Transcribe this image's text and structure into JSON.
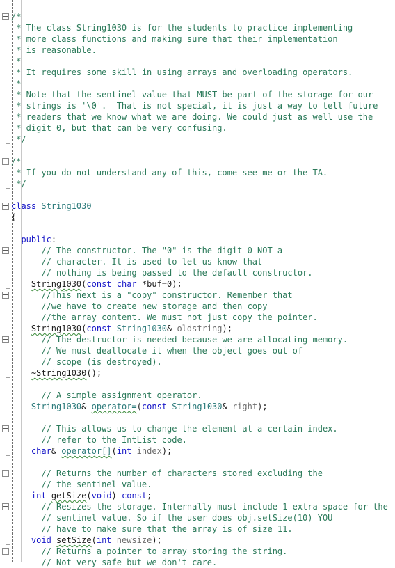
{
  "editor": {
    "language": "C++",
    "colors": {
      "comment": "#2b7a5a",
      "keyword": "#1818c8",
      "type": "#2b7a7a",
      "plain": "#1e1e1e",
      "parameter": "#6e6e6e"
    },
    "header_comment": {
      "open": "/*",
      "lines": [
        "* The class String1030 is for the students to practice implementing",
        "* more class functions and making sure that their implementation",
        "* is reasonable.",
        "*",
        "* It requires some skill in using arrays and overloading operators.",
        "*",
        "* Note that the sentinel value that MUST be part of the storage for our",
        "* strings is '\\0'.  That is not special, it is just a way to tell future",
        "* readers that we know what we are doing. We could just as well use the",
        "* digit 0, but that can be very confusing."
      ],
      "close": "*/"
    },
    "help_comment": {
      "open": "/*",
      "lines": [
        "* If you do not understand any of this, come see me or the TA."
      ],
      "close": "*/"
    },
    "class_decl": {
      "keyword": "class",
      "name": "String1030",
      "open_brace": "{",
      "access": "public",
      "access_colon": ":"
    },
    "members": {
      "ctor_comment": [
        "// The constructor. The \"0\" is the digit 0 NOT a",
        "// character. It is used to let us know that",
        "// nothing is being passed to the default constructor."
      ],
      "ctor": {
        "name": "String1030",
        "open": "(",
        "kw1": "const",
        "kw2": "char",
        "rest": " *buf=0);"
      },
      "copy_comment": [
        "//This next is a \"copy\" constructor. Remember that",
        "//we have to create new storage and then copy",
        "//the array content. We must not just copy the pointer."
      ],
      "copy_ctor": {
        "name": "String1030",
        "open": "(",
        "kw1": "const",
        "type": " String1030",
        "amp": "&",
        "param": " oldstring",
        "close": ");"
      },
      "dtor_comment": [
        "// The destructor is needed because we are allocating memory.",
        "// We must deallocate it when the object goes out of",
        "// scope (is destroyed)."
      ],
      "dtor": {
        "name": "~String1030",
        "rest": "();"
      },
      "assign_comment": [
        "// A simple assignment operator."
      ],
      "assign": {
        "ret": "String1030",
        "amp": "&",
        "name": "operator=",
        "open": "(",
        "kw1": "const",
        "type": " String1030",
        "amp2": "&",
        "param": " right",
        "close": ");"
      },
      "index_comment": [
        "// This allows us to change the element at a certain index.",
        "// refer to the IntList code."
      ],
      "index_op": {
        "ret": "char",
        "amp": "&",
        "name": "operator[]",
        "open": "(",
        "kw1": "int",
        "param": " index",
        "close": ");"
      },
      "getsize_comment": [
        "// Returns the number of characters stored excluding the",
        "// the sentinel value."
      ],
      "getsize": {
        "ret": "int",
        "name": "getSize",
        "open": "(",
        "kw1": "void",
        "close": ") ",
        "kw2": "const",
        "end": ";"
      },
      "setsize_comment": [
        "// Resizes the storage. Internally must include 1 extra space for the",
        "// sentinel value. So if the user does obj.setSize(10) YOU",
        "// have to make sure that the array is of size 11."
      ],
      "setsize": {
        "ret": "void",
        "name": "setSize",
        "open": "(",
        "kw1": "int",
        "param": " newsize",
        "close": ");"
      },
      "cstr_comment": [
        "// Returns a pointer to array storing the string.",
        "// Not very safe but we don't care."
      ]
    }
  }
}
